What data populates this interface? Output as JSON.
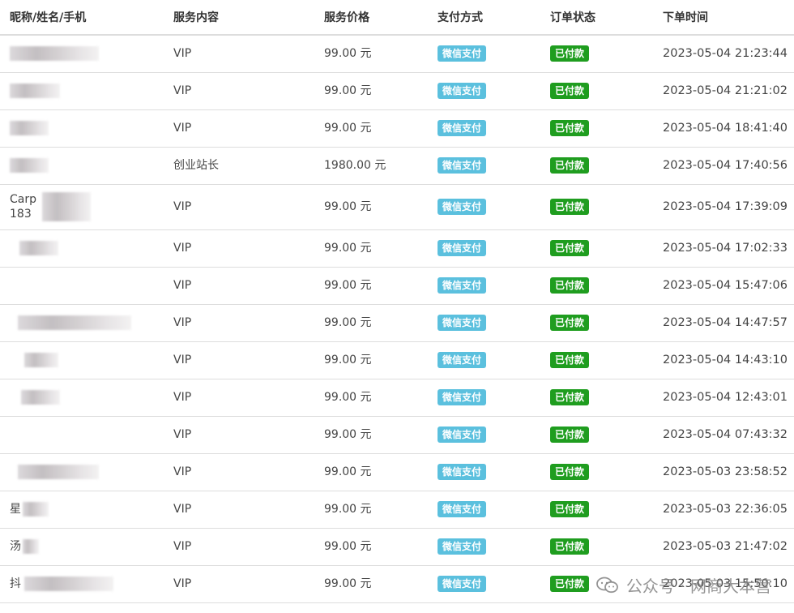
{
  "columns": [
    "昵称/姓名/手机",
    "服务内容",
    "服务价格",
    "支付方式",
    "订单状态",
    "下单时间"
  ],
  "colors": {
    "wechat_badge": "#5bc0de",
    "paid_badge": "#1f9d1f",
    "border": "#dddddd"
  },
  "rows": [
    {
      "nick": "",
      "nick2": "",
      "service": "VIP",
      "price": "99.00 元",
      "pay": "微信支付",
      "status": "已付款",
      "time": "2023-05-04 21:23:44"
    },
    {
      "nick": "",
      "nick2": "",
      "service": "VIP",
      "price": "99.00 元",
      "pay": "微信支付",
      "status": "已付款",
      "time": "2023-05-04 21:21:02"
    },
    {
      "nick": "",
      "nick2": "",
      "service": "VIP",
      "price": "99.00 元",
      "pay": "微信支付",
      "status": "已付款",
      "time": "2023-05-04 18:41:40"
    },
    {
      "nick": "",
      "nick2": "",
      "service": "创业站长",
      "price": "1980.00 元",
      "pay": "微信支付",
      "status": "已付款",
      "time": "2023-05-04 17:40:56"
    },
    {
      "nick": "Carp",
      "nick2": "183",
      "service": "VIP",
      "price": "99.00 元",
      "pay": "微信支付",
      "status": "已付款",
      "time": "2023-05-04 17:39:09"
    },
    {
      "nick": "",
      "nick2": "",
      "service": "VIP",
      "price": "99.00 元",
      "pay": "微信支付",
      "status": "已付款",
      "time": "2023-05-04 17:02:33"
    },
    {
      "nick": "",
      "nick2": "",
      "service": "VIP",
      "price": "99.00 元",
      "pay": "微信支付",
      "status": "已付款",
      "time": "2023-05-04 15:47:06"
    },
    {
      "nick": "",
      "nick2": "",
      "service": "VIP",
      "price": "99.00 元",
      "pay": "微信支付",
      "status": "已付款",
      "time": "2023-05-04 14:47:57"
    },
    {
      "nick": "",
      "nick2": "",
      "service": "VIP",
      "price": "99.00 元",
      "pay": "微信支付",
      "status": "已付款",
      "time": "2023-05-04 14:43:10"
    },
    {
      "nick": "",
      "nick2": "",
      "service": "VIP",
      "price": "99.00 元",
      "pay": "微信支付",
      "status": "已付款",
      "time": "2023-05-04 12:43:01"
    },
    {
      "nick": "",
      "nick2": "",
      "service": "VIP",
      "price": "99.00 元",
      "pay": "微信支付",
      "status": "已付款",
      "time": "2023-05-04 07:43:32"
    },
    {
      "nick": "",
      "nick2": "",
      "service": "VIP",
      "price": "99.00 元",
      "pay": "微信支付",
      "status": "已付款",
      "time": "2023-05-03 23:58:52"
    },
    {
      "nick": "星",
      "nick2": "",
      "service": "VIP",
      "price": "99.00 元",
      "pay": "微信支付",
      "status": "已付款",
      "time": "2023-05-03 22:36:05"
    },
    {
      "nick": "汤",
      "nick2": "",
      "service": "VIP",
      "price": "99.00 元",
      "pay": "微信支付",
      "status": "已付款",
      "time": "2023-05-03 21:47:02"
    },
    {
      "nick": "抖",
      "nick2": "",
      "service": "VIP",
      "price": "99.00 元",
      "pay": "微信支付",
      "status": "已付款",
      "time": "2023-05-03 15:50:10"
    }
  ],
  "watermark": {
    "text": "公众号 · 网商大本营",
    "icon": "wechat-icon"
  }
}
